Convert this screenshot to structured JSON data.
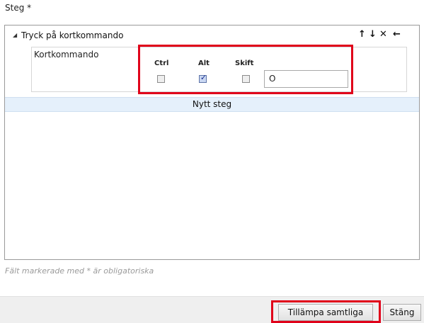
{
  "steps": {
    "label": "Steg *",
    "step": {
      "title": "Tryck på kortkommando",
      "tools": {
        "move_up": "↑",
        "move_down": "↓",
        "delete": "✕",
        "back": "←"
      },
      "shortcut_label": "Kortkommando",
      "modifiers": [
        {
          "label": "Ctrl",
          "checked": false
        },
        {
          "label": "Alt",
          "checked": true
        },
        {
          "label": "Skift",
          "checked": false
        }
      ],
      "key_value": "O"
    },
    "new_step_label": "Nytt steg"
  },
  "hint": "Fält markerade med * är obligatoriska",
  "buttons": {
    "apply_all": "Tillämpa samtliga",
    "close": "Stäng"
  },
  "colors": {
    "highlight": "#e0001a",
    "new_step_bg": "#e5f0fb"
  }
}
